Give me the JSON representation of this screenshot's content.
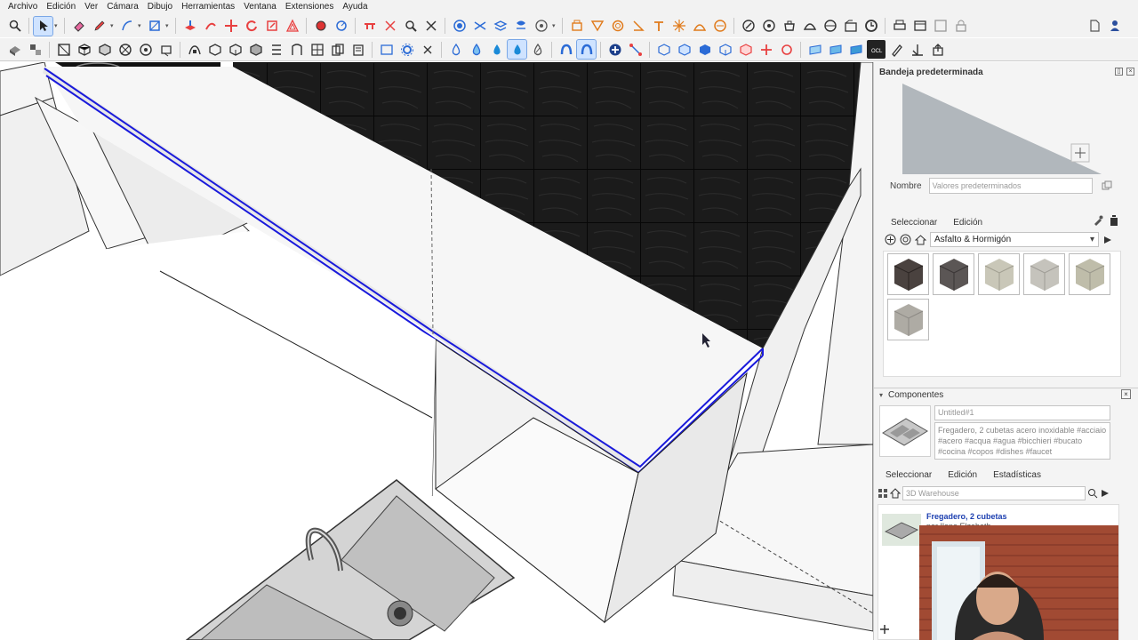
{
  "menubar": {
    "items": [
      "Archivo",
      "Edición",
      "Ver",
      "Cámara",
      "Dibujo",
      "Herramientas",
      "Ventana",
      "Extensiones",
      "Ayuda"
    ]
  },
  "toolbar1": {
    "tools": [
      "search-icon",
      "select-icon",
      "eraser-icon",
      "pencil-icon",
      "line-icon",
      "rectangle-icon",
      "push-pull-icon",
      "follow-me-icon",
      "move-icon",
      "rotate-icon",
      "scale-icon",
      "offset-icon",
      "tape-icon",
      "protractor-icon",
      "text-icon",
      "axes-icon",
      "orbit-icon",
      "pan-icon",
      "zoom-icon",
      "zoom-extents-icon",
      "solid-icon",
      "section-icon",
      "layers-icon",
      "styles-icon",
      "scenes-icon",
      "shadow-icon",
      "paint-icon",
      "sandbox-icon",
      "warehouse-icon",
      "new-file-icon",
      "user-icon"
    ]
  },
  "toolbar2": {
    "tools": [
      "materials-icon",
      "components-icon",
      "iso-view-icon",
      "top-view-icon",
      "front-view-icon",
      "right-view-icon",
      "back-view-icon",
      "left-view-icon",
      "xray-icon",
      "wireframe-icon",
      "hidden-line-icon",
      "shaded-icon",
      "textured-icon",
      "monochrome-icon",
      "select-box-icon",
      "gear-icon",
      "close-icon",
      "drop-icon",
      "magnet-icon",
      "add-icon",
      "link-icon",
      "ocl-icon",
      "export-icon"
    ]
  },
  "tray": {
    "title": "Bandeja predeterminada",
    "name_label": "Nombre",
    "name_placeholder": "Valores predeterminados",
    "materials": {
      "tab_select": "Seleccionar",
      "tab_edit": "Edición",
      "library": "Asfalto & Hormigón",
      "swatches": [
        "#4a423f",
        "#5b5655",
        "#c9c7b8",
        "#c5c3bc",
        "#bfbdaa",
        "#aeaba4"
      ]
    },
    "components": {
      "header": "Componentes",
      "name_placeholder": "Untitled#1",
      "description": "Fregadero, 2 cubetas acero inoxidable #acciaio #acero #acqua #agua #bicchieri #bucato #cocina #copos #dishes #faucet",
      "tab_select": "Seleccionar",
      "tab_edit": "Edición",
      "tab_stats": "Estadísticas",
      "search_placeholder": "3D Warehouse",
      "result_title": "Fregadero, 2 cubetas",
      "result_author": "por Ilona Elzabeth"
    }
  },
  "colors": {
    "selection": "#1a1adb",
    "toolbar_bg": "#f2f2f2",
    "tile_dark": "#1a1a1a"
  }
}
